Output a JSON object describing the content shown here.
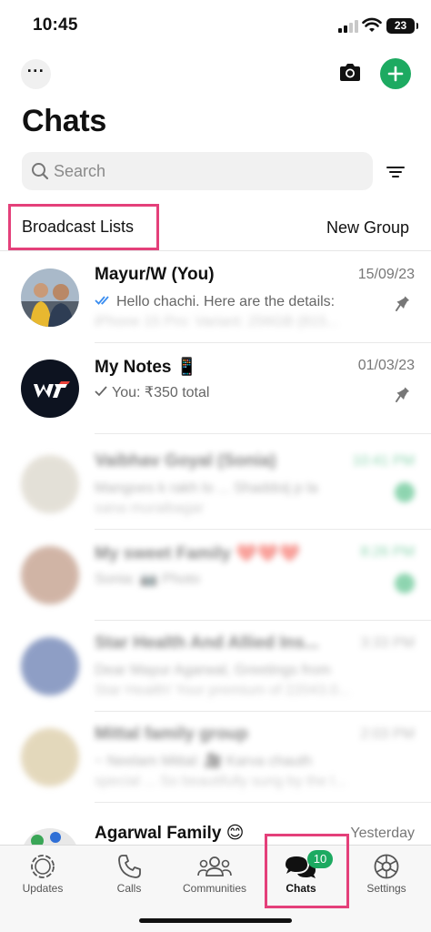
{
  "status_bar": {
    "time": "10:45",
    "battery": "23"
  },
  "header": {
    "title": "Chats",
    "more_icon": "more-horizontal-icon",
    "camera_icon": "camera-icon",
    "add_icon": "plus-icon",
    "accent": "#1daa61"
  },
  "search": {
    "placeholder": "Search",
    "filter_icon": "filter-icon"
  },
  "links": {
    "broadcast": "Broadcast Lists",
    "new_group": "New Group",
    "highlight_color": "#e4407a"
  },
  "chats": [
    {
      "name": "Mayur/W (You)",
      "time": "15/09/23",
      "preview": "Hello chachi. Here are the details:",
      "preview2": "iPhone 15 Pro: Variant: 256GB (815...",
      "pinned": true,
      "check": "double"
    },
    {
      "name": "My Notes 📱",
      "time": "01/03/23",
      "preview": "You: ₹350 total",
      "preview2": "",
      "pinned": true,
      "check": "single"
    },
    {
      "name": "Vaibhav Goyal (Sonia)",
      "time": "10:41 PM",
      "preview": "Mangoes k rakh lo ... Shaddoij p la",
      "preview2": "sana muraibagar",
      "blurred": true
    },
    {
      "name": "My sweet Family ❤️❤️❤️",
      "time": "8:26 PM",
      "preview": "Sonia: 📷 Photo",
      "preview2": "",
      "blurred": true
    },
    {
      "name": "Star Health And Allied Ins...",
      "time": "3:33 PM",
      "preview": "Dear Mayur Agarwal, Greetings from",
      "preview2": "Star Health! Your premium of 22043.0...",
      "blurred": true
    },
    {
      "name": "Mittal family group",
      "time": "2:03 PM",
      "preview": "~ Neelam Mittal: 🎥 Karva chauth",
      "preview2": "special ... So beautifully sung by the l...",
      "blurred": true
    },
    {
      "name": "Agarwal Family 😊",
      "time": "Yesterday",
      "preview": "",
      "preview2": ""
    }
  ],
  "tabs": [
    {
      "label": "Updates",
      "icon": "updates-icon"
    },
    {
      "label": "Calls",
      "icon": "phone-icon"
    },
    {
      "label": "Communities",
      "icon": "communities-icon"
    },
    {
      "label": "Chats",
      "icon": "chats-icon",
      "badge": "10",
      "active": true
    },
    {
      "label": "Settings",
      "icon": "gear-icon"
    }
  ]
}
